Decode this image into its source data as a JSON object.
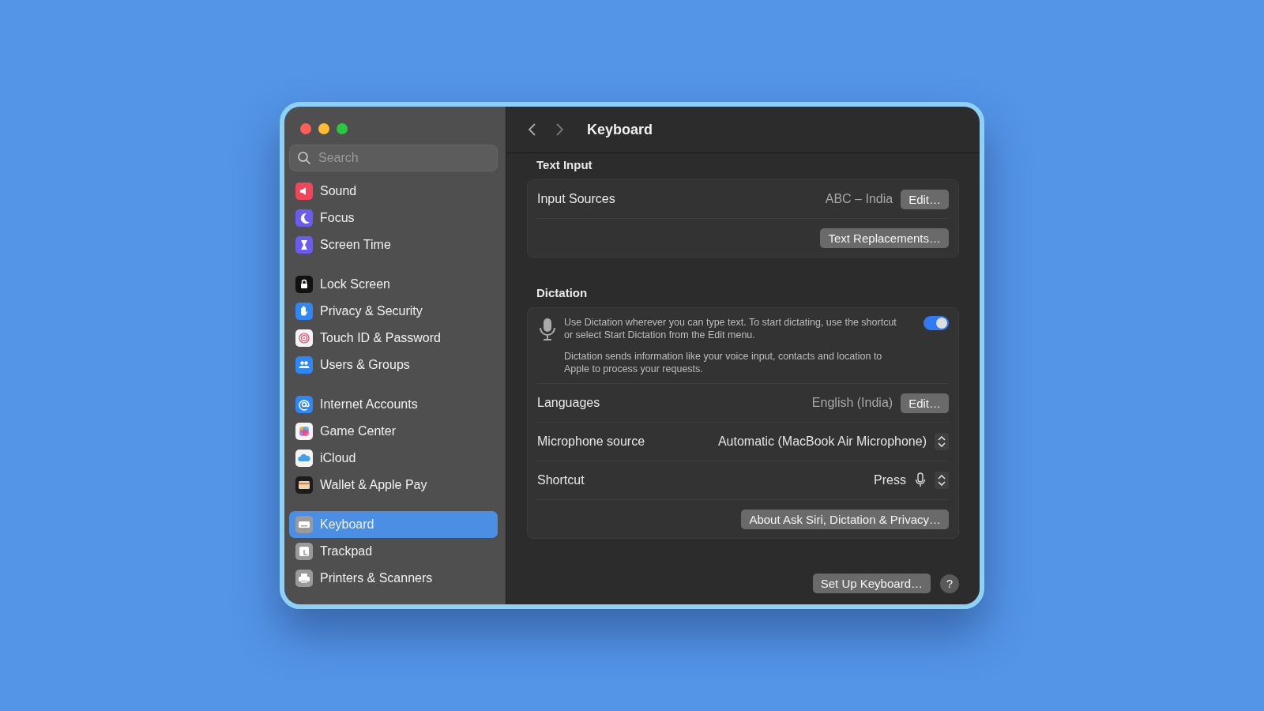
{
  "window": {
    "controls": [
      {
        "color": "#ff5f57"
      },
      {
        "color": "#febc2e"
      },
      {
        "color": "#28c840"
      }
    ]
  },
  "sidebar": {
    "search": {
      "placeholder": "Search"
    },
    "groups": [
      {
        "items": [
          {
            "label": "Sound",
            "selected": false,
            "color": "#f2455c"
          },
          {
            "label": "Focus",
            "selected": false,
            "color": "#6a5cf0"
          },
          {
            "label": "Screen Time",
            "selected": false,
            "color": "#6a5cf0"
          }
        ]
      },
      {
        "items": [
          {
            "label": "Lock Screen",
            "selected": false,
            "color": "#111111"
          },
          {
            "label": "Privacy & Security",
            "selected": false,
            "color": "#2f86f6"
          },
          {
            "label": "Touch ID & Password",
            "selected": false,
            "color": "#f4f4f4"
          },
          {
            "label": "Users & Groups",
            "selected": false,
            "color": "#2f86f6"
          }
        ]
      },
      {
        "items": [
          {
            "label": "Internet Accounts",
            "selected": false,
            "color": "#2f86f6"
          },
          {
            "label": "Game Center",
            "selected": false,
            "color": "#f4f4f4"
          },
          {
            "label": "iCloud",
            "selected": false,
            "color": "#f4f4f4"
          },
          {
            "label": "Wallet & Apple Pay",
            "selected": false,
            "color": "#1c1c1c"
          }
        ]
      },
      {
        "items": [
          {
            "label": "Keyboard",
            "selected": true,
            "color": "#9a9a9a"
          },
          {
            "label": "Trackpad",
            "selected": false,
            "color": "#9a9a9a"
          },
          {
            "label": "Printers & Scanners",
            "selected": false,
            "color": "#9a9a9a"
          }
        ]
      }
    ]
  },
  "header": {
    "title": "Keyboard"
  },
  "sections": [
    {
      "title": "Text Input",
      "rows": [
        {
          "kind": "value_button",
          "label": "Input Sources",
          "value": "ABC – India",
          "button": "Edit…"
        },
        {
          "kind": "button",
          "button": "Text Replacements…"
        }
      ]
    },
    {
      "title": "Dictation",
      "rows": [
        {
          "kind": "toggle",
          "text": "Use Dictation wherever you can type text. To start dictating, use the shortcut or select Start Dictation from the Edit menu.",
          "note": "Dictation sends information like your voice input, contacts and location to Apple to process your requests.",
          "on": true
        },
        {
          "kind": "value_button",
          "label": "Languages",
          "value": "English (India)",
          "button": "Edit…"
        },
        {
          "kind": "popup",
          "label": "Microphone source",
          "value": "Automatic (MacBook Air Microphone)"
        },
        {
          "kind": "popup_mic",
          "label": "Shortcut",
          "value": "Press"
        },
        {
          "kind": "button",
          "button": "About Ask Siri, Dictation & Privacy…"
        }
      ]
    }
  ],
  "footer": {
    "button": "Set Up Keyboard…",
    "help": "?"
  }
}
